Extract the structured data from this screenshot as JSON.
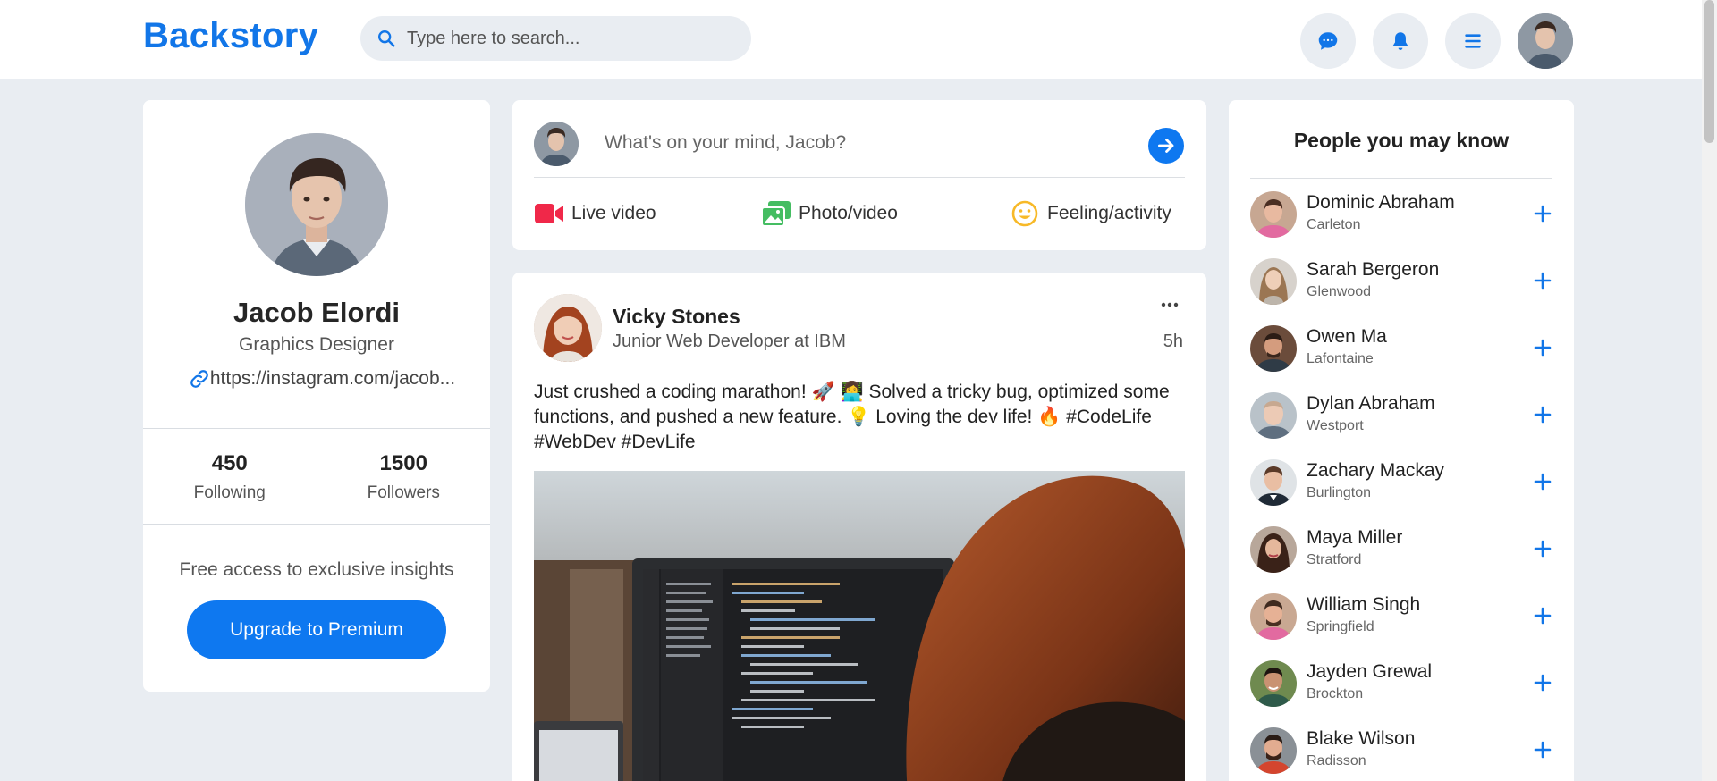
{
  "app": {
    "logo": "Backstory"
  },
  "search": {
    "placeholder": "Type here to search..."
  },
  "header_icons": [
    "chat-icon",
    "bell-icon",
    "menu-icon"
  ],
  "profile": {
    "name": "Jacob Elordi",
    "role": "Graphics Designer",
    "link": "https://instagram.com/jacob...",
    "following_count": "450",
    "following_label": "Following",
    "followers_count": "1500",
    "followers_label": "Followers",
    "premium_text": "Free access to exclusive insights",
    "premium_button": "Upgrade to Premium"
  },
  "composer": {
    "placeholder": "What's on your mind, Jacob?",
    "actions": [
      {
        "label": "Live video",
        "icon": "video-camera-icon"
      },
      {
        "label": "Photo/video",
        "icon": "photo-icon"
      },
      {
        "label": "Feeling/activity",
        "icon": "smiley-icon"
      }
    ]
  },
  "post": {
    "author": "Vicky Stones",
    "subtitle": "Junior Web Developer at IBM",
    "time": "5h",
    "text": "Just crushed a coding marathon! 🚀 👩‍💻 Solved a tricky bug, optimized some functions, and pushed a new feature. 💡 Loving the dev life! 🔥 #CodeLife #WebDev #DevLife"
  },
  "suggestions": {
    "title": "People you may know",
    "people": [
      {
        "name": "Dominic Abraham",
        "city": "Carleton"
      },
      {
        "name": "Sarah Bergeron",
        "city": "Glenwood"
      },
      {
        "name": "Owen Ma",
        "city": "Lafontaine"
      },
      {
        "name": "Dylan Abraham",
        "city": "Westport"
      },
      {
        "name": "Zachary Mackay",
        "city": "Burlington"
      },
      {
        "name": "Maya Miller",
        "city": "Stratford"
      },
      {
        "name": "William Singh",
        "city": "Springfield"
      },
      {
        "name": "Jayden Grewal",
        "city": "Brockton"
      },
      {
        "name": "Blake Wilson",
        "city": "Radisson"
      }
    ]
  },
  "colors": {
    "accent": "#0e78f0",
    "logo": "#1276e8",
    "background": "#e9edf2",
    "live_video": "#f02849",
    "photo": "#45bd62",
    "feeling": "#f7b928"
  }
}
